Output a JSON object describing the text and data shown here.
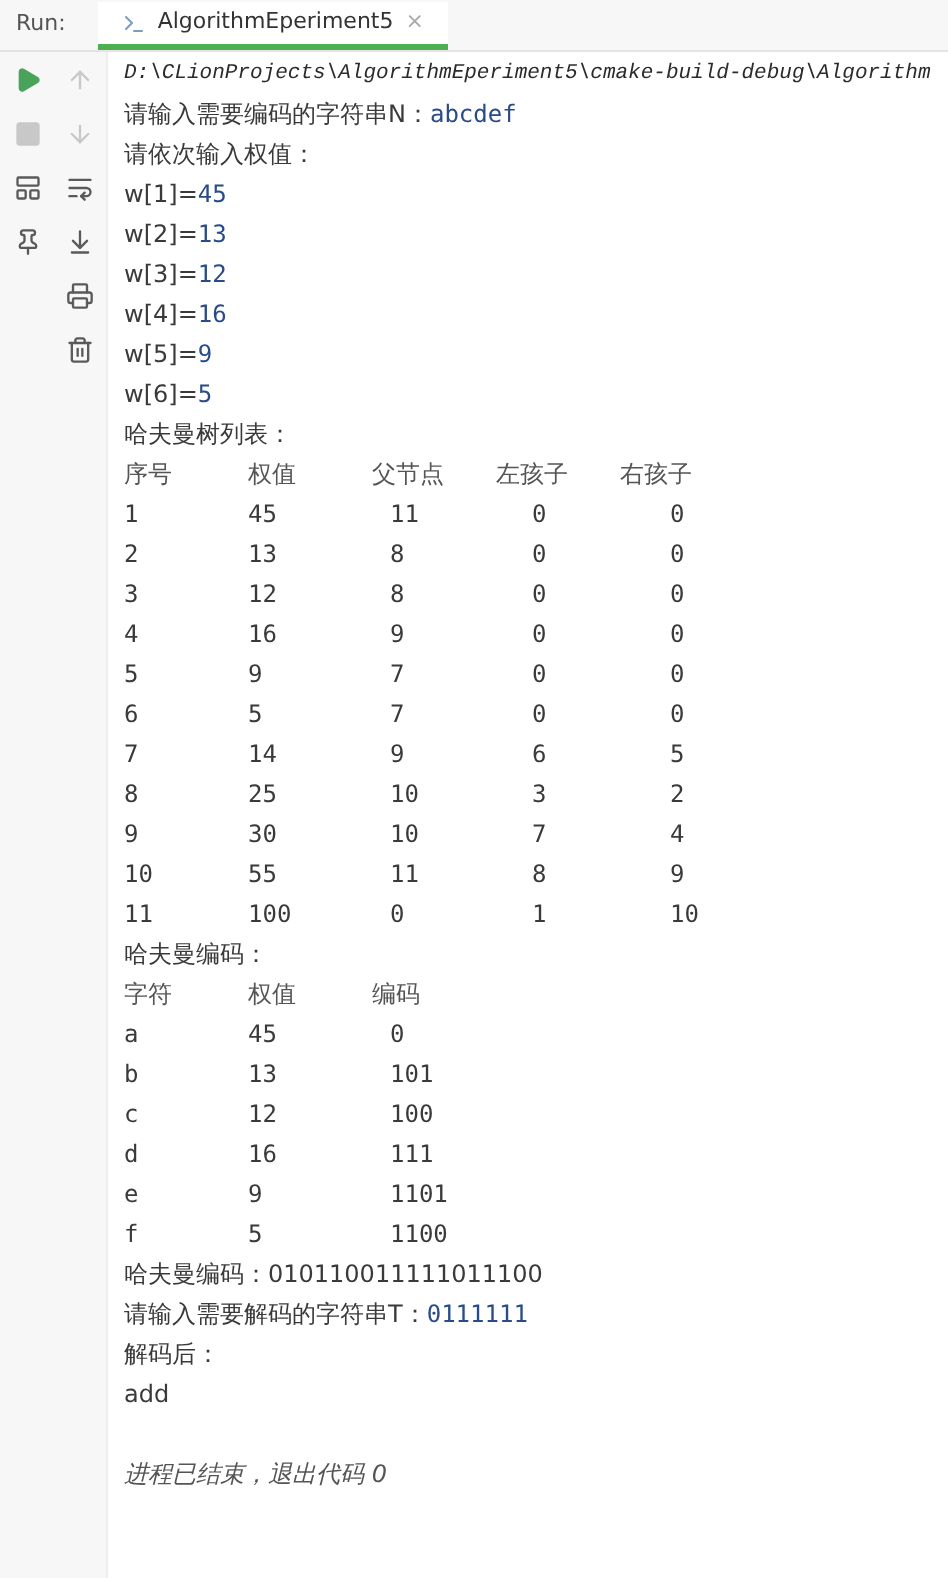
{
  "run_label": "Run:",
  "tabs": [
    {
      "label": "AlgorithmEperiment5",
      "selected": true,
      "close": "×"
    }
  ],
  "toolbar_left": [
    {
      "disabled": false
    },
    {
      "disabled": true
    },
    {
      "disabled": false
    },
    {
      "disabled": false
    }
  ],
  "toolbar_right": [
    {
      "disabled": true
    },
    {
      "disabled": true
    },
    {
      "disabled": false
    },
    {
      "disabled": false
    },
    {
      "disabled": false
    },
    {
      "disabled": false
    }
  ],
  "console": [
    {
      "kind": "path",
      "text": "D:\\CLionProjects\\AlgorithmEperiment5\\cmake-build-debug\\Algorithm"
    },
    {
      "kind": "prompt",
      "text": "请输入需要编码的字符串N：",
      "input": "abcdef"
    },
    {
      "kind": "text",
      "text": "请依次输入权值："
    },
    {
      "kind": "prompt",
      "text": "w[1]=",
      "input": "45"
    },
    {
      "kind": "prompt",
      "text": "w[2]=",
      "input": "13"
    },
    {
      "kind": "prompt",
      "text": "w[3]=",
      "input": "12"
    },
    {
      "kind": "prompt",
      "text": "w[4]=",
      "input": "16"
    },
    {
      "kind": "prompt",
      "text": "w[5]=",
      "input": "9"
    },
    {
      "kind": "prompt",
      "text": "w[6]=",
      "input": "5"
    },
    {
      "kind": "text",
      "text": "哈夫曼树列表："
    },
    {
      "kind": "header",
      "cells": [
        "序号",
        "权值",
        "父节点",
        "左孩子",
        "右孩子"
      ]
    },
    {
      "kind": "row",
      "cells": [
        "1",
        "45",
        "11",
        "0",
        "0"
      ]
    },
    {
      "kind": "row",
      "cells": [
        "2",
        "13",
        "8",
        "0",
        "0"
      ]
    },
    {
      "kind": "row",
      "cells": [
        "3",
        "12",
        "8",
        "0",
        "0"
      ]
    },
    {
      "kind": "row",
      "cells": [
        "4",
        "16",
        "9",
        "0",
        "0"
      ]
    },
    {
      "kind": "row",
      "cells": [
        "5",
        "9",
        "7",
        "0",
        "0"
      ]
    },
    {
      "kind": "row",
      "cells": [
        "6",
        "5",
        "7",
        "0",
        "0"
      ]
    },
    {
      "kind": "row",
      "cells": [
        "7",
        "14",
        "9",
        "6",
        "5"
      ]
    },
    {
      "kind": "row",
      "cells": [
        "8",
        "25",
        "10",
        "3",
        "2"
      ]
    },
    {
      "kind": "row",
      "cells": [
        "9",
        "30",
        "10",
        "7",
        "4"
      ]
    },
    {
      "kind": "row",
      "cells": [
        "10",
        "55",
        "11",
        "8",
        "9"
      ]
    },
    {
      "kind": "row",
      "cells": [
        "11",
        "100",
        "0",
        "1",
        "10"
      ]
    },
    {
      "kind": "text",
      "text": "哈夫曼编码："
    },
    {
      "kind": "header",
      "cells": [
        "字符",
        "权值",
        "编码"
      ]
    },
    {
      "kind": "row",
      "cells": [
        "a",
        "45",
        "0"
      ]
    },
    {
      "kind": "row",
      "cells": [
        "b",
        "13",
        "101"
      ]
    },
    {
      "kind": "row",
      "cells": [
        "c",
        "12",
        "100"
      ]
    },
    {
      "kind": "row",
      "cells": [
        "d",
        "16",
        "111"
      ]
    },
    {
      "kind": "row",
      "cells": [
        "e",
        "9",
        "1101"
      ]
    },
    {
      "kind": "row",
      "cells": [
        "f",
        "5",
        "1100"
      ]
    },
    {
      "kind": "text",
      "text": "哈夫曼编码：010110011111011100"
    },
    {
      "kind": "prompt",
      "text": "请输入需要解码的字符串T：",
      "input": "0111111"
    },
    {
      "kind": "text",
      "text": "解码后："
    },
    {
      "kind": "text",
      "text": "add"
    },
    {
      "kind": "exit",
      "text": "进程已结束，退出代码 0"
    }
  ]
}
